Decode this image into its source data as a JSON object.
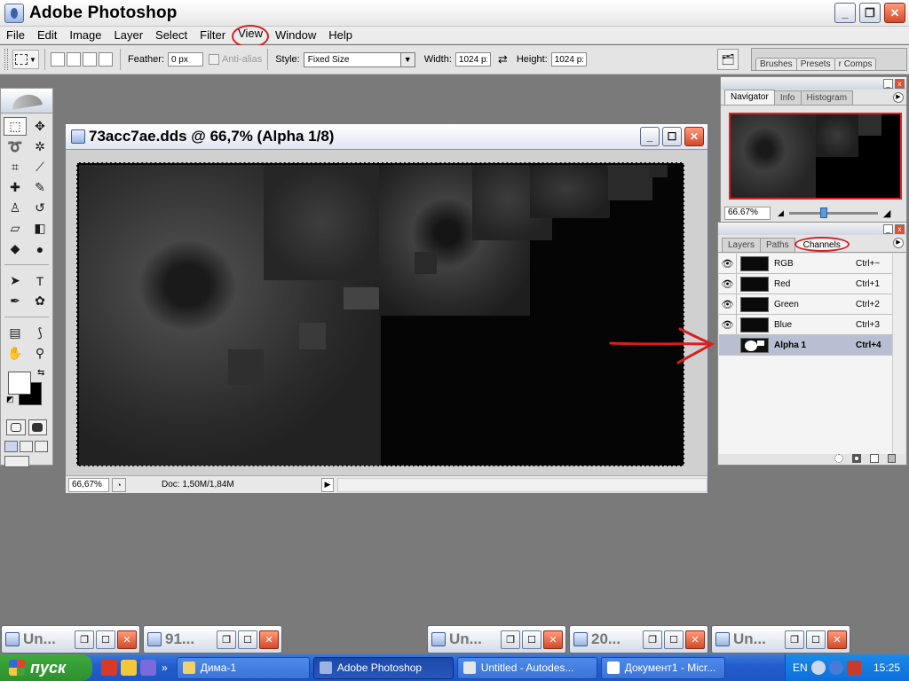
{
  "window": {
    "title": "Adobe Photoshop"
  },
  "menu": {
    "items": [
      "File",
      "Edit",
      "Image",
      "Layer",
      "Select",
      "Filter",
      "View",
      "Window",
      "Help"
    ]
  },
  "options": {
    "feather_label": "Feather:",
    "feather_value": "0 px",
    "antialias_label": "Anti-alias",
    "style_label": "Style:",
    "style_value": "Fixed Size",
    "width_label": "Width:",
    "width_value": "1024 p:",
    "height_label": "Height:",
    "height_value": "1024 p:",
    "well_tabs": [
      "Brushes",
      "Presets",
      "r Comps"
    ]
  },
  "document": {
    "title": "73acc7ae.dds @ 66,7% (Alpha 1/8)",
    "zoom": "66,67%",
    "doc_size": "Doc: 1,50M/1,84M"
  },
  "navigator": {
    "tabs": [
      "Navigator",
      "Info",
      "Histogram"
    ],
    "zoom": "66.67%"
  },
  "channels": {
    "tabs": [
      "Layers",
      "Paths",
      "Channels"
    ],
    "rows": [
      {
        "name": "RGB",
        "shortcut": "Ctrl+~"
      },
      {
        "name": "Red",
        "shortcut": "Ctrl+1"
      },
      {
        "name": "Green",
        "shortcut": "Ctrl+2"
      },
      {
        "name": "Blue",
        "shortcut": "Ctrl+3"
      },
      {
        "name": "Alpha 1",
        "shortcut": "Ctrl+4"
      }
    ]
  },
  "minimized": [
    {
      "title": "Un..."
    },
    {
      "title": "91..."
    },
    {
      "title": "Un..."
    },
    {
      "title": "20..."
    },
    {
      "title": "Un..."
    }
  ],
  "taskbar": {
    "start_label": "пуск",
    "tasks": [
      "Дима-1",
      "Adobe Photoshop",
      "Untitled - Autodes...",
      "Документ1 - Micr..."
    ],
    "lang": "EN",
    "clock": "15:25"
  },
  "colors": {
    "annotation_red": "#d42020",
    "xp_blue": "#245ecf",
    "xp_green": "#3faa3f"
  }
}
